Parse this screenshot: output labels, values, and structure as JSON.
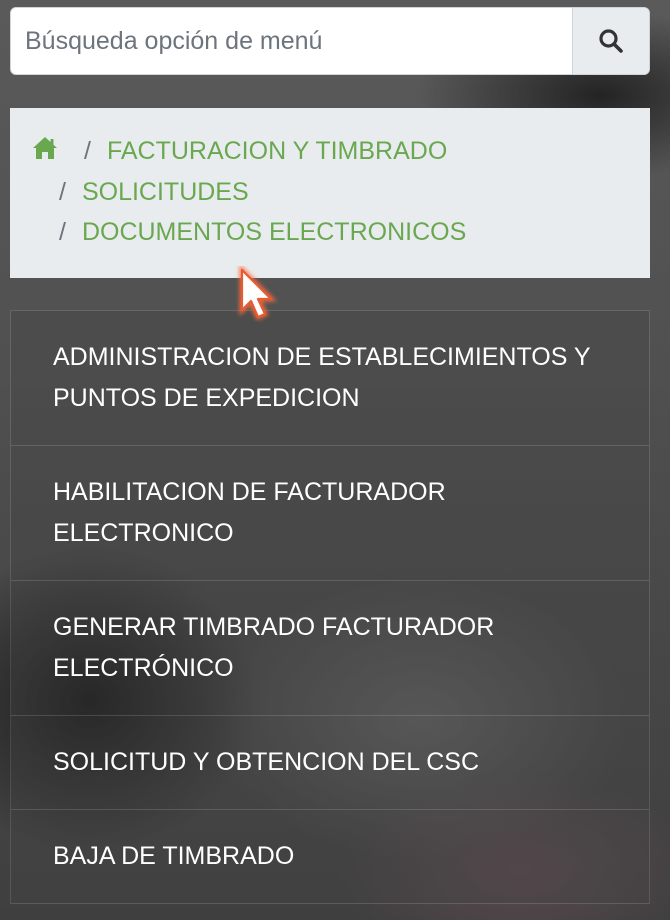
{
  "search": {
    "placeholder": "Búsqueda opción de menú",
    "value": "",
    "button_icon": "search-icon"
  },
  "breadcrumb": {
    "home_icon": "home-icon",
    "separator": "/",
    "items": [
      {
        "label": "FACTURACION Y TIMBRADO"
      },
      {
        "label": "SOLICITUDES"
      },
      {
        "label": "DOCUMENTOS ELECTRONICOS"
      }
    ],
    "link_color": "#6aa84f"
  },
  "menu": {
    "items": [
      {
        "line1": "ADMINISTRACION DE ESTABLECIMIENTOS Y",
        "line2": "PUNTOS DE EXPEDICION"
      },
      {
        "line1": "HABILITACION DE FACTURADOR",
        "line2": "ELECTRONICO"
      },
      {
        "line1": "GENERAR TIMBRADO FACTURADOR",
        "line2": "ELECTRÓNICO"
      },
      {
        "line1": "SOLICITUD Y OBTENCION DEL CSC",
        "line2": ""
      },
      {
        "line1": "BAJA DE TIMBRADO",
        "line2": ""
      }
    ]
  },
  "pointer": {
    "icon": "mouse-pointer-icon"
  }
}
